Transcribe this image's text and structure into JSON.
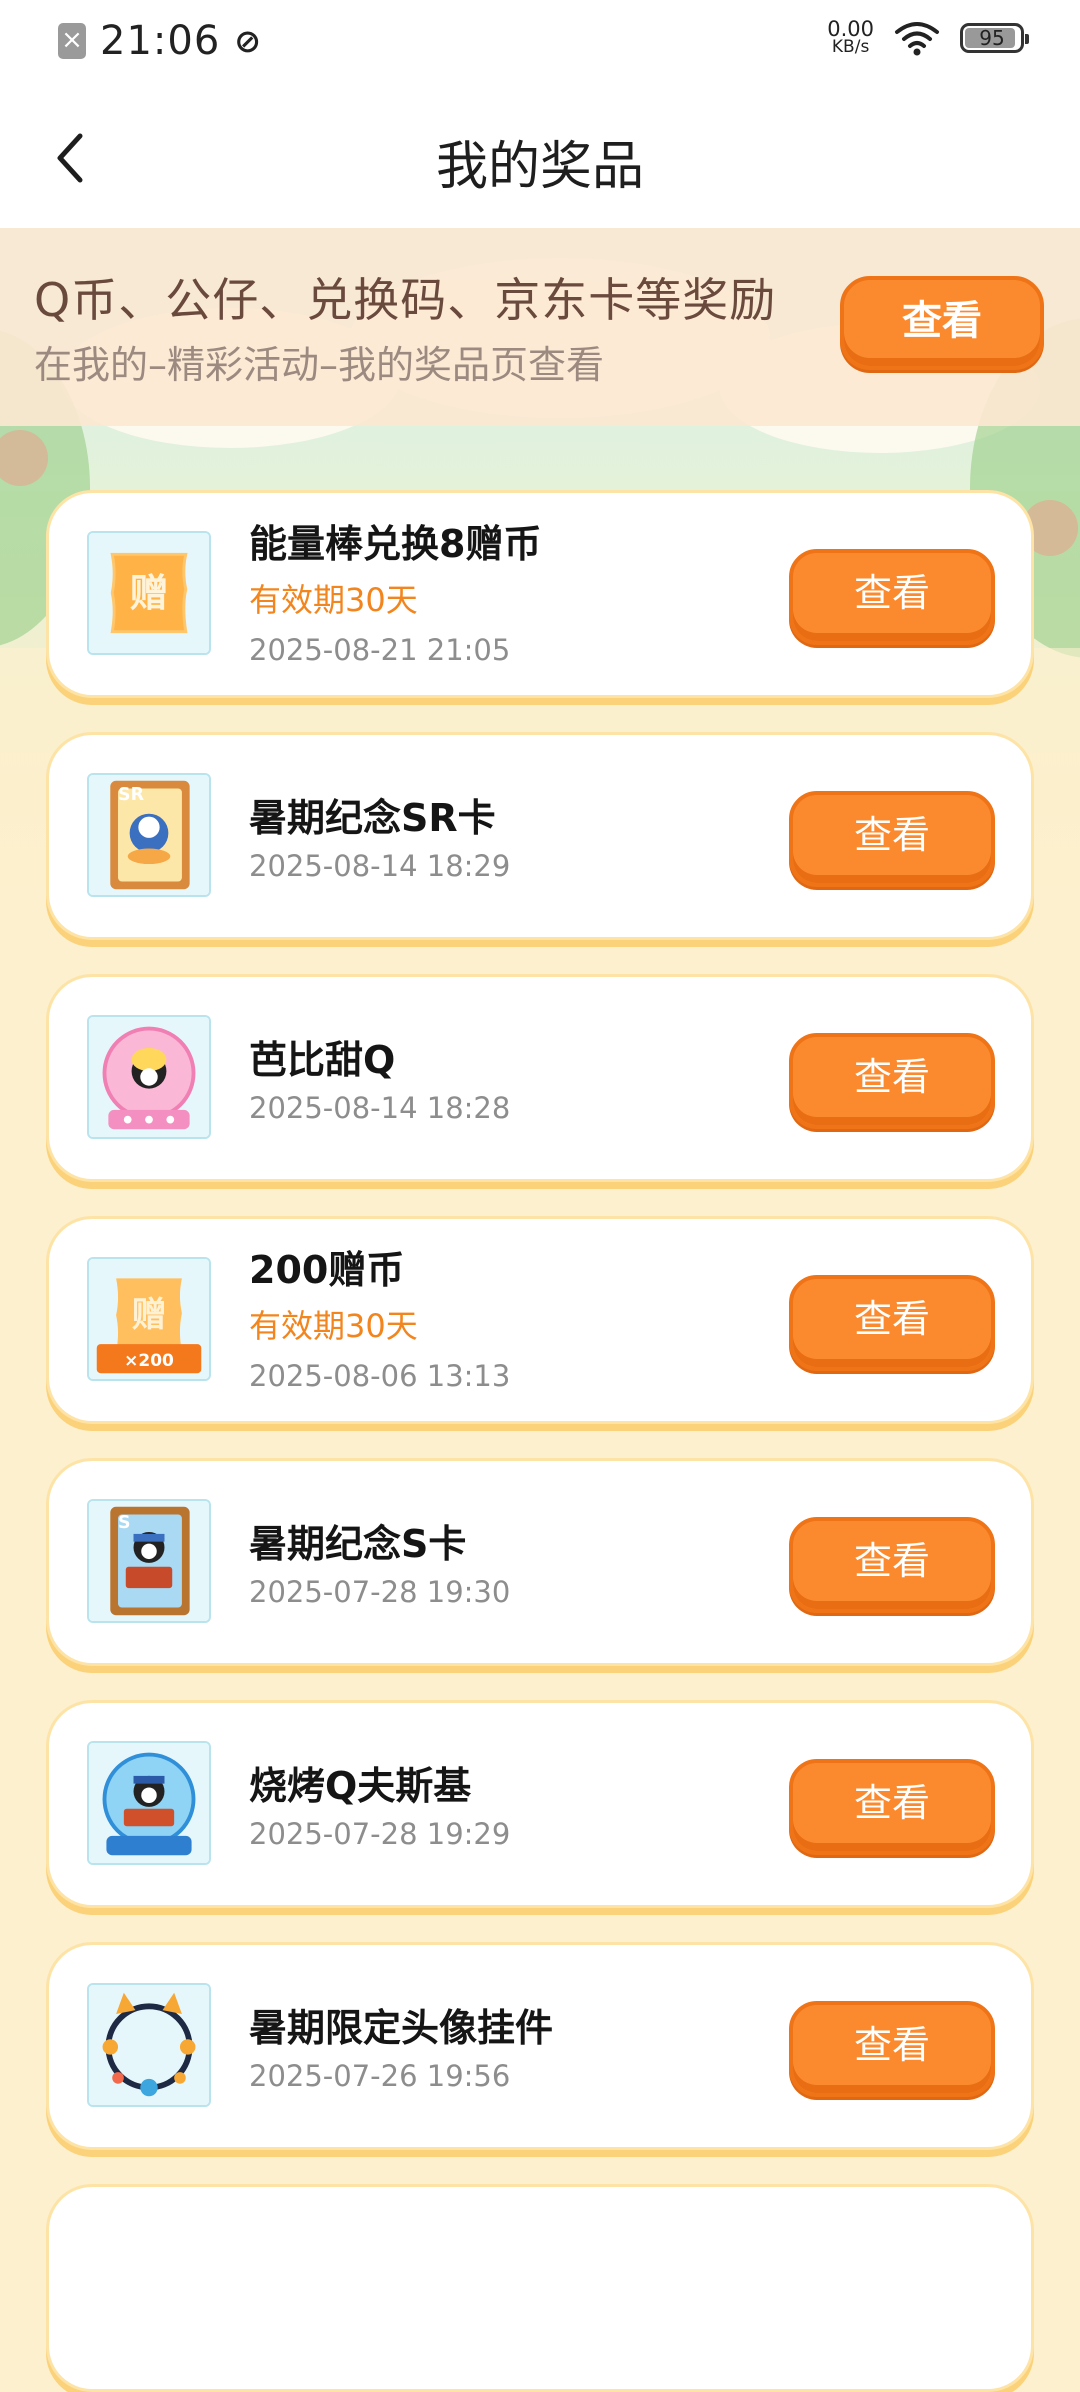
{
  "status_bar": {
    "time": "21:06",
    "net_speed": "0.00",
    "net_unit": "KB/s",
    "battery": "95",
    "icons": [
      "sim-off-icon",
      "no-signal-icon",
      "wifi-icon",
      "battery-icon"
    ]
  },
  "header": {
    "title": "我的奖品",
    "back_icon": "chevron-left-icon"
  },
  "banner": {
    "title": "Q币、公仔、兑换码、京东卡等奖励",
    "subtitle": "在我的–精彩活动–我的奖品页查看",
    "button": "查看"
  },
  "prizes": [
    {
      "name": "能量棒兑换8赠币",
      "validity": "有效期30天",
      "date": "2025-08-21 21:05",
      "button": "查看",
      "thumb": "gift-coupon-icon"
    },
    {
      "name": "暑期纪念SR卡",
      "validity": "",
      "date": "2025-08-14 18:29",
      "button": "查看",
      "thumb": "sr-card-icon"
    },
    {
      "name": "芭比甜Q",
      "validity": "",
      "date": "2025-08-14 18:28",
      "button": "查看",
      "thumb": "snow-globe-pink-icon"
    },
    {
      "name": "200赠币",
      "validity": "有效期30天",
      "date": "2025-08-06 13:13",
      "button": "查看",
      "thumb": "gift-coin-200-icon",
      "badge": "×200"
    },
    {
      "name": "暑期纪念S卡",
      "validity": "",
      "date": "2025-07-28 19:30",
      "button": "查看",
      "thumb": "s-card-icon"
    },
    {
      "name": "烧烤Q夫斯基",
      "validity": "",
      "date": "2025-07-28 19:29",
      "button": "查看",
      "thumb": "snow-globe-blue-icon"
    },
    {
      "name": "暑期限定头像挂件",
      "validity": "",
      "date": "2025-07-26 19:56",
      "button": "查看",
      "thumb": "avatar-frame-icon"
    }
  ],
  "colors": {
    "accent": "#fb8a2e",
    "validity": "#f2851d",
    "background": "#fdf0cf"
  }
}
